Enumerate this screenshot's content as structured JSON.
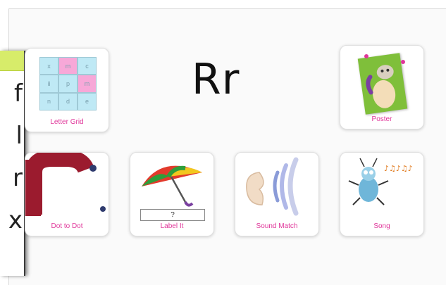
{
  "title": "Rr",
  "side_panel": {
    "letters": [
      "f",
      "l",
      "r",
      "x"
    ]
  },
  "tiles": [
    {
      "label": "Letter Grid",
      "icon": "letter-grid-icon"
    },
    {
      "label": "Poster",
      "icon": "poster-icon"
    },
    {
      "label": "Dot to Dot",
      "icon": "dot-to-dot-icon"
    },
    {
      "label": "Label It",
      "icon": "umbrella-icon",
      "answer_box": "?"
    },
    {
      "label": "Sound Match",
      "icon": "ear-icon"
    },
    {
      "label": "Song",
      "icon": "bug-singer-icon"
    }
  ],
  "letter_grid": {
    "cells": [
      "x",
      "m",
      "c",
      "ii",
      "p",
      "m",
      "n",
      "d",
      "e"
    ],
    "colors": [
      "blue",
      "pink",
      "blue",
      "blue",
      "blue",
      "pink",
      "blue",
      "blue",
      "blue"
    ]
  },
  "colors": {
    "label_pink": "#e0369a",
    "strip_green": "#d7ec6a",
    "letter_r_red": "#9b1b2e"
  }
}
